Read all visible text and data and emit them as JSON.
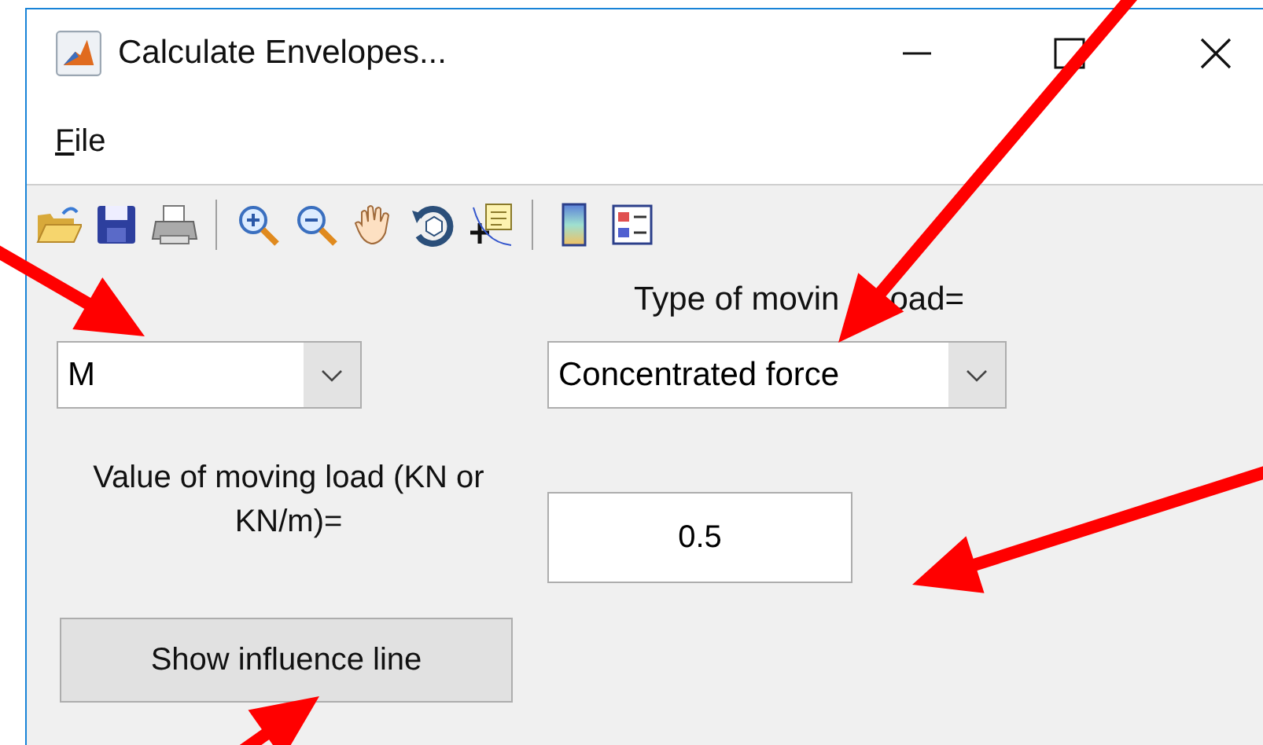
{
  "window": {
    "title": "Calculate Envelopes..."
  },
  "menu": [
    {
      "label": "File"
    }
  ],
  "toolbar": [
    {
      "kind": "open"
    },
    {
      "kind": "save"
    },
    {
      "kind": "print"
    },
    {
      "kind": "separator"
    },
    {
      "kind": "zoom-in"
    },
    {
      "kind": "zoom-out"
    },
    {
      "kind": "pan"
    },
    {
      "kind": "rotate"
    },
    {
      "kind": "datatip"
    },
    {
      "kind": "separator"
    },
    {
      "kind": "colorbar"
    },
    {
      "kind": "legend"
    }
  ],
  "quantity_dropdown": {
    "value": "M"
  },
  "load_type": {
    "label_parts": [
      "Type of movin",
      "oad="
    ],
    "value": "Concentrated force"
  },
  "load_value": {
    "label": "Value of moving load (KN or KN/m)=",
    "value": "0.5"
  },
  "button": {
    "label": "Show influence line"
  }
}
